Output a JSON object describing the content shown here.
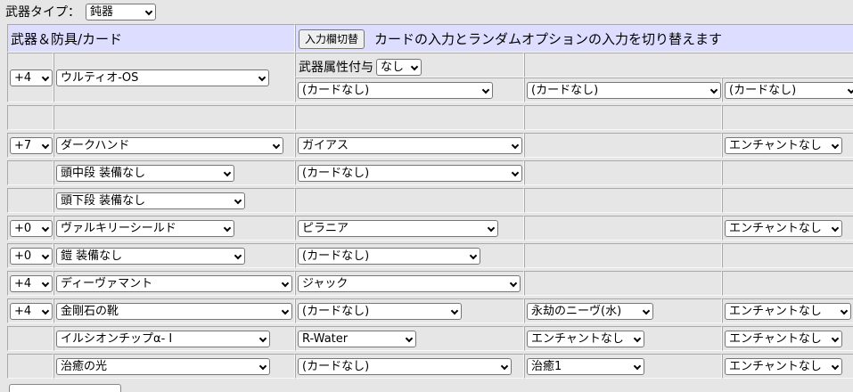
{
  "top": {
    "label": "武器タイプ：",
    "weapon_type": "鈍器"
  },
  "header": {
    "left_title": "武器＆防具/カード",
    "toggle_button": "入力欄切替",
    "description": "カードの入力とランダムオプションの入力を切り替えます"
  },
  "weapon": {
    "refine": "+4",
    "name": "ウルティオ-OS",
    "element_label": "武器属性付与",
    "element_value": "なし",
    "card1": "(カードなし)",
    "card2": "(カードなし)",
    "card3": "(カードなし)"
  },
  "rows": {
    "head_top": {
      "refine": "+7",
      "name": "ダークハンド",
      "card": "ガイアス",
      "enchant": "エンチャントなし"
    },
    "head_mid": {
      "name": "頭中段 装備なし",
      "card": "(カードなし)"
    },
    "head_low": {
      "name": "頭下段 装備なし"
    },
    "shield": {
      "refine": "+0",
      "name": "ヴァルキリーシールド",
      "card": "ピラニア",
      "enchant": "エンチャントなし"
    },
    "armor": {
      "refine": "+0",
      "name": "鎧 装備なし",
      "card": "(カードなし)"
    },
    "garment": {
      "refine": "+4",
      "name": "ディーヴァマント",
      "card": "ジャック"
    },
    "shoes": {
      "refine": "+4",
      "name": "金剛石の靴",
      "card": "(カードなし)",
      "opt1": "永劫のニーヴ(水)",
      "enchant": "エンチャントなし"
    },
    "acc1": {
      "name": "イルシオンチップα- I",
      "card": "R-Water",
      "opt1": "エンチャントなし",
      "enchant": "エンチャントなし"
    },
    "acc2": {
      "name": "治癒の光",
      "card": "(カードなし)",
      "opt1": "治癒1",
      "enchant": "エンチャントなし"
    }
  }
}
